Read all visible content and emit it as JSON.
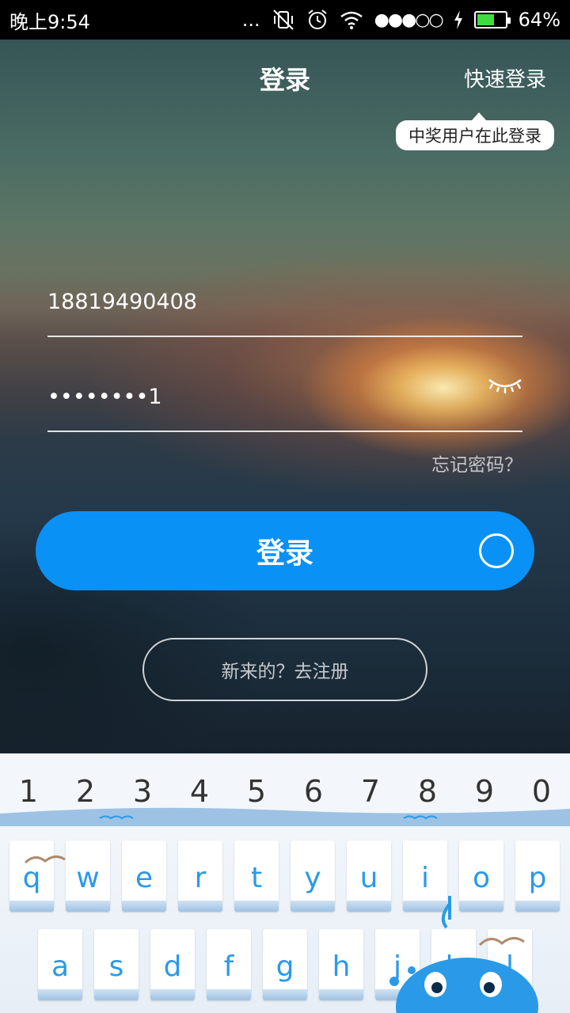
{
  "status_bar": {
    "time": "晚上9:54",
    "more": "...",
    "battery": "64%",
    "battery_level": 0.64
  },
  "header": {
    "title": "登录",
    "quick_login": "快速登录",
    "tooltip": "中奖用户在此登录"
  },
  "form": {
    "phone_value": "18819490408",
    "password_value": "••••••••1",
    "forgot": "忘记密码？",
    "login_label": "登录",
    "register_label": "新来的？去注册"
  },
  "keyboard": {
    "numbers": [
      "1",
      "2",
      "3",
      "4",
      "5",
      "6",
      "7",
      "8",
      "9",
      "0"
    ],
    "row1": [
      "q",
      "w",
      "e",
      "r",
      "t",
      "y",
      "u",
      "i",
      "o",
      "p"
    ],
    "row2": [
      "a",
      "s",
      "d",
      "f",
      "g",
      "h",
      "j",
      "k",
      "l"
    ]
  },
  "colors": {
    "login_button": "#0a91f5",
    "key_text": "#2a9ae8"
  }
}
